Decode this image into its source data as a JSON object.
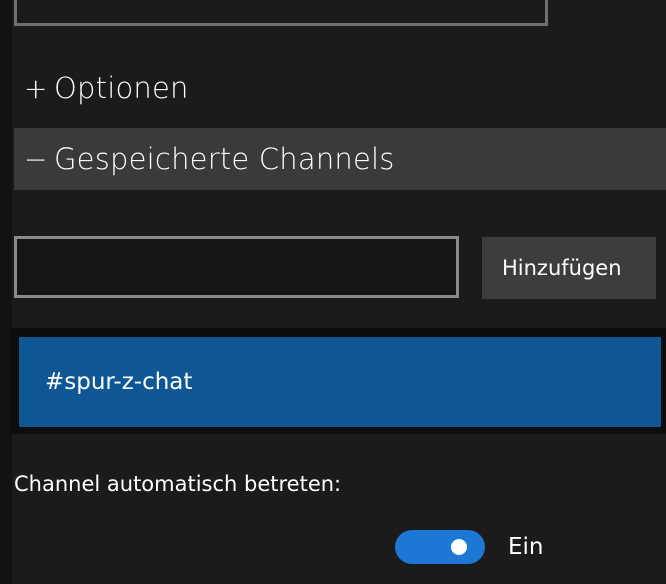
{
  "sections": {
    "options": {
      "sign": "+",
      "title": "Optionen"
    },
    "saved_channels": {
      "sign": "−",
      "title": "Gespeicherte Channels"
    }
  },
  "channel_input": {
    "value": "",
    "placeholder": ""
  },
  "add_button": {
    "label": "Hinzufügen"
  },
  "channels": [
    {
      "name": "#spur-z-chat",
      "selected": true
    }
  ],
  "auto_join": {
    "label": "Channel automatisch betreten:",
    "enabled": true,
    "state_label": "Ein"
  },
  "colors": {
    "background": "#1b1b1b",
    "header_bg": "#3a3a3a",
    "selected_item": "#0f5694",
    "toggle_on": "#1c78d4",
    "button_bg": "#3d3d3d"
  }
}
